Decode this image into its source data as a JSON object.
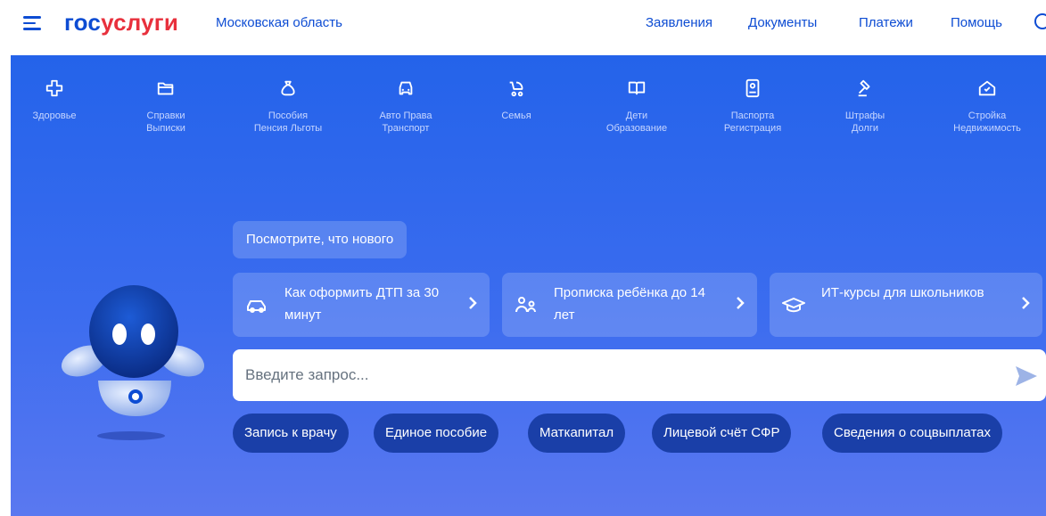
{
  "header": {
    "logo_part1": "гос",
    "logo_part2": "услуги",
    "region": "Московская область",
    "nav": [
      "Заявления",
      "Документы",
      "Платежи",
      "Помощь"
    ]
  },
  "categories": [
    {
      "label": "Здоровье",
      "icon": "health-cross-icon"
    },
    {
      "label": "Справки\nВыписки",
      "icon": "folder-icon"
    },
    {
      "label": "Пособия\nПенсия Льготы",
      "icon": "money-bag-icon"
    },
    {
      "label": "Авто Права\nТранспорт",
      "icon": "car-icon"
    },
    {
      "label": "Семья",
      "icon": "stroller-icon"
    },
    {
      "label": "Дети\nОбразование",
      "icon": "book-icon"
    },
    {
      "label": "Паспорта\nРегистрация",
      "icon": "passport-icon"
    },
    {
      "label": "Штрафы\nДолги",
      "icon": "gavel-icon"
    },
    {
      "label": "Стройка\nНедвижимость",
      "icon": "house-icon"
    }
  ],
  "whats_new": "Посмотрите, что нового",
  "cards": [
    {
      "text": "Как оформить ДТП за 30 минут",
      "icon": "car-icon"
    },
    {
      "text": "Прописка ребёнка до 14 лет",
      "icon": "people-icon"
    },
    {
      "text": "ИТ-курсы для школьников",
      "icon": "graduation-cap-icon"
    }
  ],
  "search": {
    "placeholder": "Введите запрос..."
  },
  "chips": [
    "Запись к врачу",
    "Единое пособие",
    "Маткапитал",
    "Лицевой счёт СФР",
    "Сведения о соцвыплатах"
  ],
  "colors": {
    "brand_blue": "#0d4cd3",
    "brand_red": "#e8303c",
    "hero_bg": "#2f67ee",
    "chip_bg": "#1a3fa8"
  }
}
